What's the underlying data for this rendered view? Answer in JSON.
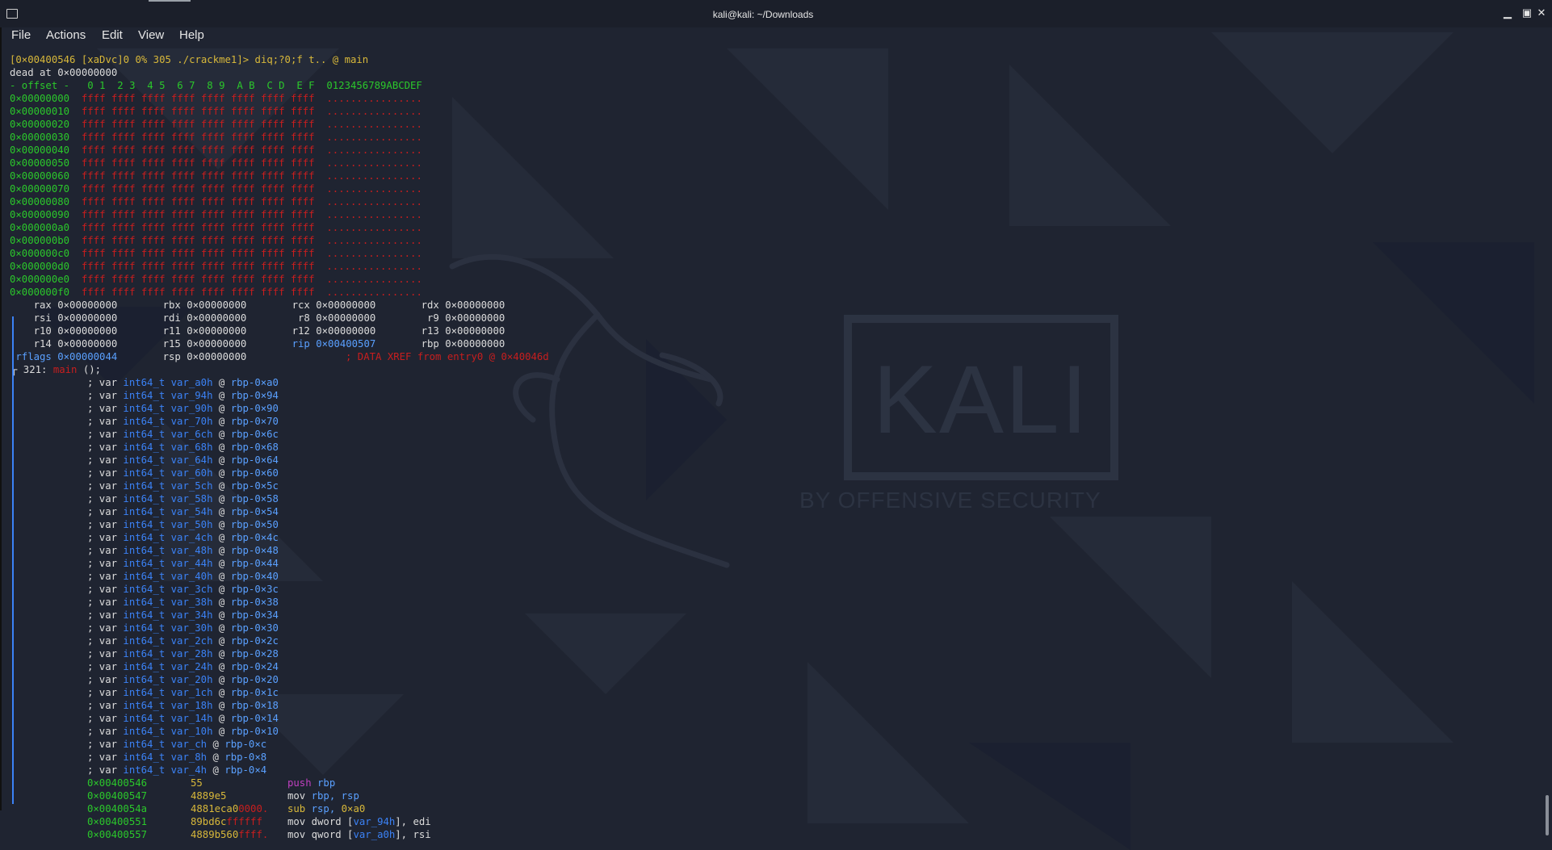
{
  "window": {
    "title": "kali@kali: ~/Downloads",
    "minimize_glyph": "▁",
    "maximize_glyph": "▣",
    "close_glyph": "✕"
  },
  "menu": [
    "File",
    "Actions",
    "Edit",
    "View",
    "Help"
  ],
  "watermark": {
    "logo_text": "KALI",
    "tagline": "BY OFFENSIVE SECURITY"
  },
  "terminal": {
    "prompt": "[0×00400546 [xaDvc]0 0% 305 ./crackme1]> diq;?0;f t.. @ main",
    "dead_line": "dead at 0×00000000",
    "hex_header": "- offset -   0 1  2 3  4 5  6 7  8 9  A B  C D  E F  0123456789ABCDEF",
    "hex_rows": [
      {
        "offset": "0×00000000",
        "bytes": "ffff ffff ffff ffff ffff ffff ffff ffff",
        "ascii": "................"
      },
      {
        "offset": "0×00000010",
        "bytes": "ffff ffff ffff ffff ffff ffff ffff ffff",
        "ascii": "................"
      },
      {
        "offset": "0×00000020",
        "bytes": "ffff ffff ffff ffff ffff ffff ffff ffff",
        "ascii": "................"
      },
      {
        "offset": "0×00000030",
        "bytes": "ffff ffff ffff ffff ffff ffff ffff ffff",
        "ascii": "................"
      },
      {
        "offset": "0×00000040",
        "bytes": "ffff ffff ffff ffff ffff ffff ffff ffff",
        "ascii": "................"
      },
      {
        "offset": "0×00000050",
        "bytes": "ffff ffff ffff ffff ffff ffff ffff ffff",
        "ascii": "................"
      },
      {
        "offset": "0×00000060",
        "bytes": "ffff ffff ffff ffff ffff ffff ffff ffff",
        "ascii": "................"
      },
      {
        "offset": "0×00000070",
        "bytes": "ffff ffff ffff ffff ffff ffff ffff ffff",
        "ascii": "................"
      },
      {
        "offset": "0×00000080",
        "bytes": "ffff ffff ffff ffff ffff ffff ffff ffff",
        "ascii": "................"
      },
      {
        "offset": "0×00000090",
        "bytes": "ffff ffff ffff ffff ffff ffff ffff ffff",
        "ascii": "................"
      },
      {
        "offset": "0×000000a0",
        "bytes": "ffff ffff ffff ffff ffff ffff ffff ffff",
        "ascii": "................"
      },
      {
        "offset": "0×000000b0",
        "bytes": "ffff ffff ffff ffff ffff ffff ffff ffff",
        "ascii": "................"
      },
      {
        "offset": "0×000000c0",
        "bytes": "ffff ffff ffff ffff ffff ffff ffff ffff",
        "ascii": "................"
      },
      {
        "offset": "0×000000d0",
        "bytes": "ffff ffff ffff ffff ffff ffff ffff ffff",
        "ascii": "................"
      },
      {
        "offset": "0×000000e0",
        "bytes": "ffff ffff ffff ffff ffff ffff ffff ffff",
        "ascii": "................"
      },
      {
        "offset": "0×000000f0",
        "bytes": "ffff ffff ffff ffff ffff ffff ffff ffff",
        "ascii": "................"
      }
    ],
    "registers": [
      [
        {
          "name": "rax",
          "value": "0×00000000"
        },
        {
          "name": "rbx",
          "value": "0×00000000"
        },
        {
          "name": "rcx",
          "value": "0×00000000"
        },
        {
          "name": "rdx",
          "value": "0×00000000"
        }
      ],
      [
        {
          "name": "rsi",
          "value": "0×00000000"
        },
        {
          "name": "rdi",
          "value": "0×00000000"
        },
        {
          "name": "r8",
          "value": "0×00000000"
        },
        {
          "name": "r9",
          "value": "0×00000000"
        }
      ],
      [
        {
          "name": "r10",
          "value": "0×00000000"
        },
        {
          "name": "r11",
          "value": "0×00000000"
        },
        {
          "name": "r12",
          "value": "0×00000000"
        },
        {
          "name": "r13",
          "value": "0×00000000"
        }
      ],
      [
        {
          "name": "r14",
          "value": "0×00000000"
        },
        {
          "name": "r15",
          "value": "0×00000000"
        },
        {
          "name": "rip",
          "value": "0×00400507"
        },
        {
          "name": "rbp",
          "value": "0×00000000"
        }
      ]
    ],
    "rflags": {
      "name": "rflags",
      "value": "0×00000044",
      "rsp_name": "rsp",
      "rsp_value": "0×00000000",
      "xref": "; DATA XREF from entry0 @ 0×40046d"
    },
    "func_header": {
      "prefix": "┌ 321: ",
      "name": "main",
      "suffix": " ();"
    },
    "vars": [
      {
        "name": "var_a0h",
        "off": "rbp-0×a0"
      },
      {
        "name": "var_94h",
        "off": "rbp-0×94"
      },
      {
        "name": "var_90h",
        "off": "rbp-0×90"
      },
      {
        "name": "var_70h",
        "off": "rbp-0×70"
      },
      {
        "name": "var_6ch",
        "off": "rbp-0×6c"
      },
      {
        "name": "var_68h",
        "off": "rbp-0×68"
      },
      {
        "name": "var_64h",
        "off": "rbp-0×64"
      },
      {
        "name": "var_60h",
        "off": "rbp-0×60"
      },
      {
        "name": "var_5ch",
        "off": "rbp-0×5c"
      },
      {
        "name": "var_58h",
        "off": "rbp-0×58"
      },
      {
        "name": "var_54h",
        "off": "rbp-0×54"
      },
      {
        "name": "var_50h",
        "off": "rbp-0×50"
      },
      {
        "name": "var_4ch",
        "off": "rbp-0×4c"
      },
      {
        "name": "var_48h",
        "off": "rbp-0×48"
      },
      {
        "name": "var_44h",
        "off": "rbp-0×44"
      },
      {
        "name": "var_40h",
        "off": "rbp-0×40"
      },
      {
        "name": "var_3ch",
        "off": "rbp-0×3c"
      },
      {
        "name": "var_38h",
        "off": "rbp-0×38"
      },
      {
        "name": "var_34h",
        "off": "rbp-0×34"
      },
      {
        "name": "var_30h",
        "off": "rbp-0×30"
      },
      {
        "name": "var_2ch",
        "off": "rbp-0×2c"
      },
      {
        "name": "var_28h",
        "off": "rbp-0×28"
      },
      {
        "name": "var_24h",
        "off": "rbp-0×24"
      },
      {
        "name": "var_20h",
        "off": "rbp-0×20"
      },
      {
        "name": "var_1ch",
        "off": "rbp-0×1c"
      },
      {
        "name": "var_18h",
        "off": "rbp-0×18"
      },
      {
        "name": "var_14h",
        "off": "rbp-0×14"
      },
      {
        "name": "var_10h",
        "off": "rbp-0×10"
      },
      {
        "name": "var_ch",
        "off": "rbp-0×c"
      },
      {
        "name": "var_8h",
        "off": "rbp-0×8"
      },
      {
        "name": "var_4h",
        "off": "rbp-0×4"
      }
    ],
    "var_prefix": "; var ",
    "var_type": "int64_t",
    "disasm": [
      {
        "addr": "0×00400546",
        "bytes_y": "55",
        "bytes_r": "",
        "mnem": "push",
        "mnem_color": "magenta",
        "ops": [
          {
            "t": "rbp",
            "c": "lblue"
          }
        ]
      },
      {
        "addr": "0×00400547",
        "bytes_y": "4889e5",
        "bytes_r": "",
        "mnem": "mov",
        "mnem_color": "white",
        "ops": [
          {
            "t": "rbp, rsp",
            "c": "lblue"
          }
        ]
      },
      {
        "addr": "0×0040054a",
        "bytes_y": "4881eca0",
        "bytes_r": "0000.",
        "mnem": "sub",
        "mnem_color": "yellow",
        "ops": [
          {
            "t": "rsp, ",
            "c": "lblue"
          },
          {
            "t": "0×a0",
            "c": "yellow"
          }
        ]
      },
      {
        "addr": "0×00400551",
        "bytes_y": "89bd6c",
        "bytes_r": "ffffff",
        "mnem": "mov",
        "mnem_color": "white",
        "ops": [
          {
            "t": "dword [",
            "c": "white"
          },
          {
            "t": "var_94h",
            "c": "blue"
          },
          {
            "t": "], edi",
            "c": "white"
          }
        ]
      },
      {
        "addr": "0×00400557",
        "bytes_y": "4889b560",
        "bytes_r": "ffff.",
        "mnem": "mov",
        "mnem_color": "white",
        "ops": [
          {
            "t": "qword [",
            "c": "white"
          },
          {
            "t": "var_a0h",
            "c": "blue"
          },
          {
            "t": "], rsi",
            "c": "white"
          }
        ]
      }
    ]
  }
}
